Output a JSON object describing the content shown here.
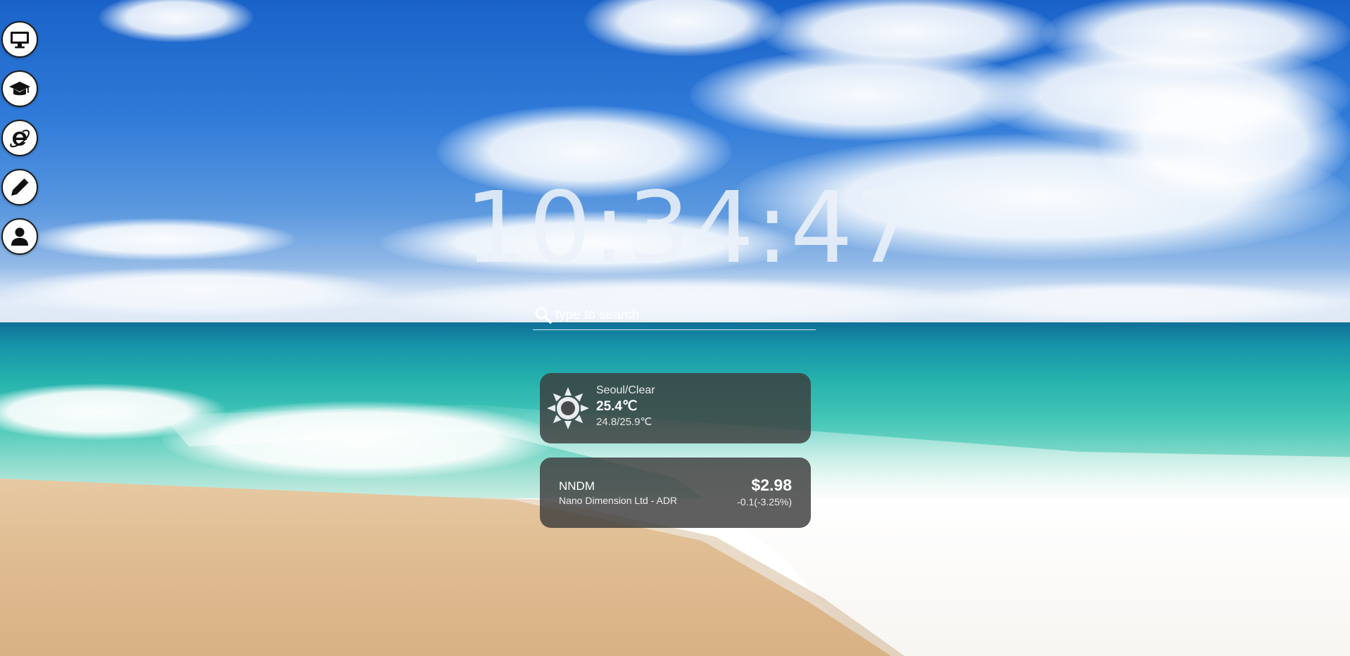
{
  "dock": {
    "items": [
      {
        "icon": "desktop-icon"
      },
      {
        "icon": "graduation-cap-icon"
      },
      {
        "icon": "internet-explorer-icon"
      },
      {
        "icon": "pencil-icon"
      },
      {
        "icon": "user-icon"
      }
    ]
  },
  "clock": {
    "time": "10:34:47"
  },
  "search": {
    "placeholder": "type to search",
    "value": ""
  },
  "weather": {
    "location": "Seoul/Clear",
    "temperature": "25.4℃",
    "range": "24.8/25.9℃",
    "icon": "sun-icon"
  },
  "stock": {
    "symbol": "NNDM",
    "name": "Nano Dimension Ltd - ADR",
    "price": "$2.98",
    "change": "-0.1(-3.25%)"
  },
  "colors": {
    "card_background": "#3c3c3c",
    "clock_text": "#ecf1f9",
    "dock_button": "#ffffff"
  }
}
